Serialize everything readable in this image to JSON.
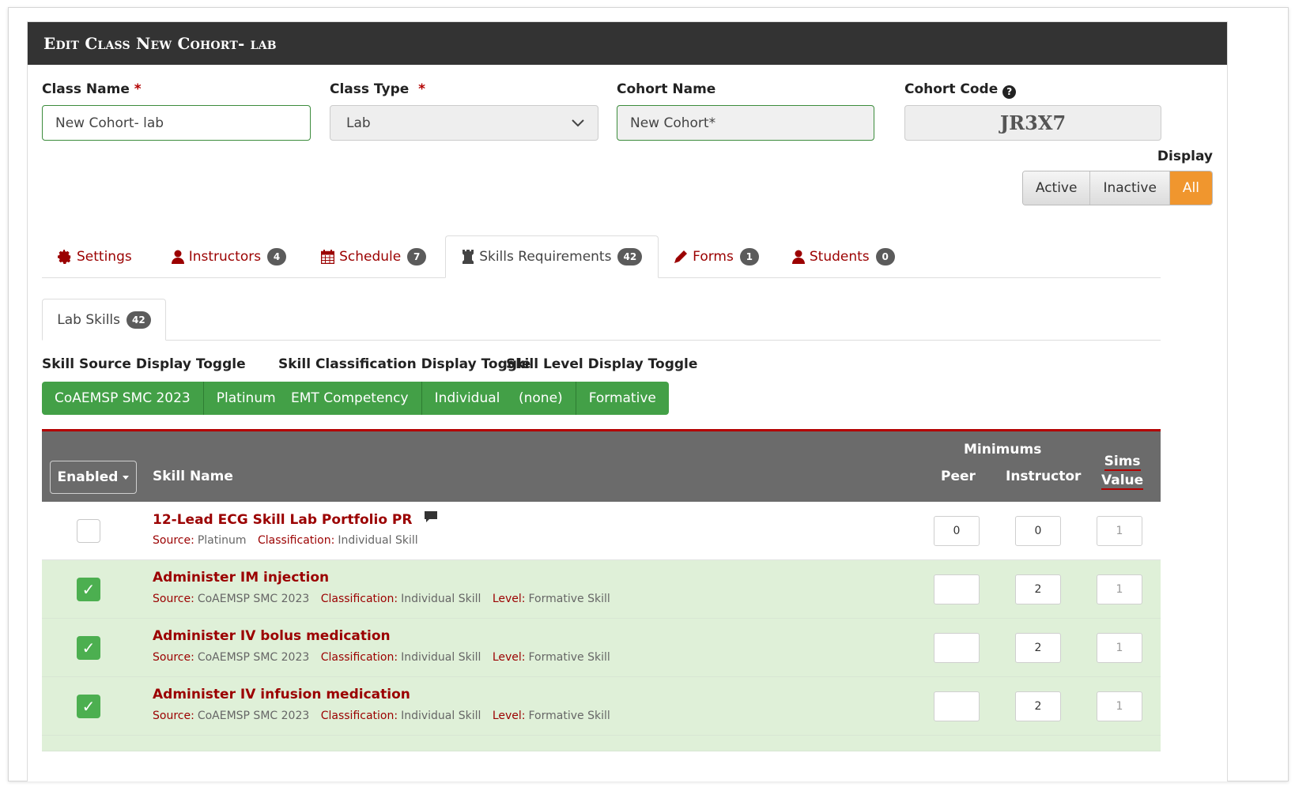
{
  "header": {
    "title": "Edit Class New Cohort- lab"
  },
  "form": {
    "class_name": {
      "label": "Class Name",
      "required": "*",
      "value": "New Cohort- lab"
    },
    "class_type": {
      "label": "Class Type",
      "required": "*",
      "value": "Lab"
    },
    "cohort_name": {
      "label": "Cohort Name",
      "value": "New Cohort*"
    },
    "cohort_code": {
      "label": "Cohort Code",
      "value": "JR3X7",
      "help_icon": "question-circle-icon"
    }
  },
  "display": {
    "label": "Display",
    "options": [
      "Active",
      "Inactive",
      "All"
    ],
    "selected": "All"
  },
  "tabs": [
    {
      "label": "Settings",
      "icon": "gear-icon",
      "badge": ""
    },
    {
      "label": "Instructors",
      "icon": "user-icon",
      "badge": "4"
    },
    {
      "label": "Schedule",
      "icon": "calendar-icon",
      "badge": "7"
    },
    {
      "label": "Skills Requirements",
      "icon": "chess-rook-icon",
      "badge": "42",
      "active": true
    },
    {
      "label": "Forms",
      "icon": "pencil-icon",
      "badge": "1"
    },
    {
      "label": "Students",
      "icon": "user-icon",
      "badge": "0"
    }
  ],
  "subtab": {
    "label": "Lab Skills",
    "badge": "42"
  },
  "toggles": {
    "source": {
      "label": "Skill Source Display Toggle",
      "options": [
        "CoAEMSP SMC 2023",
        "Platinum"
      ]
    },
    "classification": {
      "label": "Skill Classification Display Toggle",
      "options": [
        "EMT Competency",
        "Individual"
      ]
    },
    "level": {
      "label": "Skill Level Display Toggle",
      "options": [
        "(none)",
        "Formative"
      ]
    }
  },
  "table": {
    "enabled_label": "Enabled",
    "skill_name_header": "Skill Name",
    "minimums_header": "Minimums",
    "peer_header": "Peer",
    "instructor_header": "Instructor",
    "sims_header_1": "Sims",
    "sims_header_2": "Value",
    "meta_labels": {
      "source": "Source:",
      "classification": "Classification:",
      "level": "Level:"
    },
    "rows": [
      {
        "name": "12-Lead ECG Skill Lab Portfolio PR",
        "enabled": false,
        "has_comment": true,
        "source": "Platinum",
        "classification": "Individual Skill",
        "level": "",
        "peer": "0",
        "instructor": "0",
        "sims": "1"
      },
      {
        "name": "Administer IM injection",
        "enabled": true,
        "has_comment": false,
        "source": "CoAEMSP SMC 2023",
        "classification": "Individual Skill",
        "level": "Formative Skill",
        "peer": "",
        "instructor": "2",
        "sims": "1"
      },
      {
        "name": "Administer IV bolus medication",
        "enabled": true,
        "has_comment": false,
        "source": "CoAEMSP SMC 2023",
        "classification": "Individual Skill",
        "level": "Formative Skill",
        "peer": "",
        "instructor": "2",
        "sims": "1"
      },
      {
        "name": "Administer IV infusion medication",
        "enabled": true,
        "has_comment": false,
        "source": "CoAEMSP SMC 2023",
        "classification": "Individual Skill",
        "level": "Formative Skill",
        "peer": "",
        "instructor": "2",
        "sims": "1"
      }
    ]
  },
  "colors": {
    "header_bg": "#333333",
    "accent_red": "#9b0000",
    "green": "#43a047",
    "orange": "#f0962e",
    "row_green": "#dff0d8"
  }
}
